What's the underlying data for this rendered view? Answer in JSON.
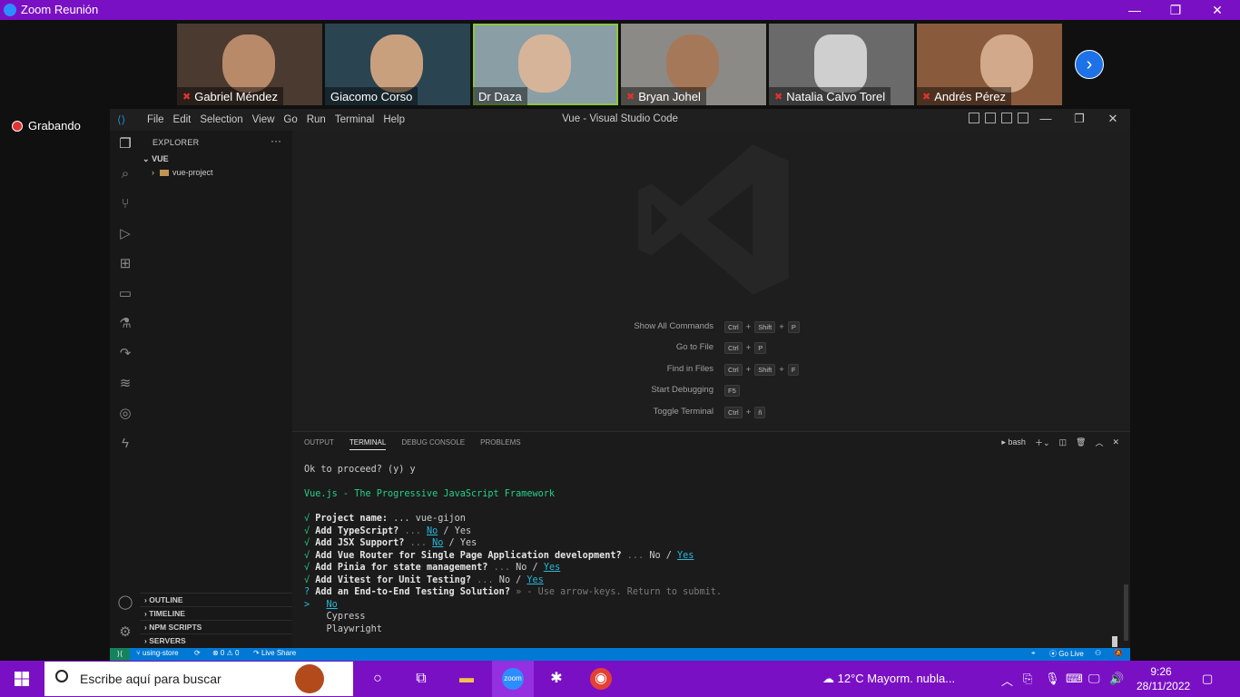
{
  "zoom": {
    "title": "Zoom Reunión",
    "recording_label": "Grabando",
    "participants": [
      {
        "name": "Gabriel Méndez",
        "muted": true
      },
      {
        "name": "Giacomo Corso",
        "muted": false
      },
      {
        "name": "Dr Daza",
        "muted": false
      },
      {
        "name": "Bryan Johel",
        "muted": true
      },
      {
        "name": "Natalia Calvo Torel",
        "muted": true
      },
      {
        "name": "Andrés Pérez",
        "muted": true
      }
    ]
  },
  "vscode": {
    "window_title": "Vue - Visual Studio Code",
    "menu": [
      "File",
      "Edit",
      "Selection",
      "View",
      "Go",
      "Run",
      "Terminal",
      "Help"
    ],
    "explorer": {
      "header": "EXPLORER",
      "workspace": "VUE",
      "folder": "vue-project",
      "sections": [
        "OUTLINE",
        "TIMELINE",
        "NPM SCRIPTS",
        "SERVERS"
      ]
    },
    "shortcuts": [
      {
        "label": "Show All Commands",
        "keys": [
          "Ctrl",
          "Shift",
          "P"
        ]
      },
      {
        "label": "Go to File",
        "keys": [
          "Ctrl",
          "P"
        ]
      },
      {
        "label": "Find in Files",
        "keys": [
          "Ctrl",
          "Shift",
          "F"
        ]
      },
      {
        "label": "Start Debugging",
        "keys": [
          "F5"
        ]
      },
      {
        "label": "Toggle Terminal",
        "keys": [
          "Ctrl",
          "ñ"
        ]
      }
    ],
    "panel": {
      "tabs": [
        "OUTPUT",
        "TERMINAL",
        "DEBUG CONSOLE",
        "PROBLEMS"
      ],
      "active_tab": "TERMINAL",
      "shell": "bash"
    },
    "terminal": {
      "proceed": "Ok to proceed? (y) y",
      "banner": "Vue.js - The Progressive JavaScript Framework",
      "check": "√",
      "q_mark": "?",
      "project_label": "Project name:",
      "project_value": "... vue-gijon",
      "ts_label": "Add TypeScript?",
      "jsx_label": "Add JSX Support?",
      "router_label": "Add Vue Router for Single Page Application development?",
      "pinia_label": "Add Pinia for state management?",
      "vitest_label": "Add Vitest for Unit Testing?",
      "e2e_label": "Add an End-to-End Testing Solution?",
      "e2e_hint": "» - Use arrow-keys. Return to submit.",
      "dots": "...",
      "no": "No",
      "yes": "Yes",
      "sep": "/",
      "pointer": ">",
      "options": [
        "No",
        "Cypress",
        "Playwright"
      ]
    },
    "statusbar": {
      "branch": "using-store",
      "problems": "⊗ 0 ⚠ 0",
      "live_share": "Live Share",
      "go_live": "Go Live"
    }
  },
  "taskbar": {
    "search_placeholder": "Escribe aquí para buscar",
    "weather": "12°C  Mayorm. nubla...",
    "time": "9:26",
    "date": "28/11/2022"
  },
  "colors": {
    "zoom_purple": "#7a10c4",
    "vscode_blue": "#0078d4",
    "term_green": "#23d18b",
    "term_link": "#29b8db"
  }
}
